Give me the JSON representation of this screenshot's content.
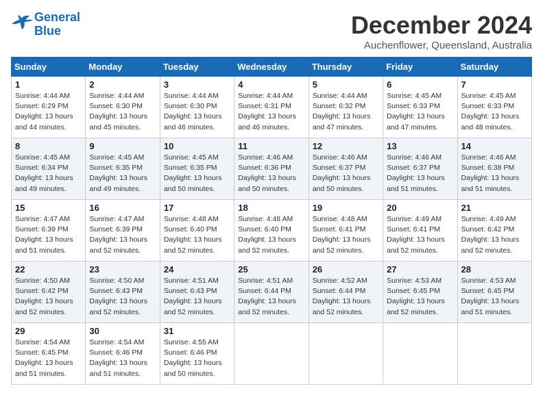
{
  "logo": {
    "line1": "General",
    "line2": "Blue"
  },
  "title": "December 2024",
  "subtitle": "Auchenflower, Queensland, Australia",
  "headers": [
    "Sunday",
    "Monday",
    "Tuesday",
    "Wednesday",
    "Thursday",
    "Friday",
    "Saturday"
  ],
  "weeks": [
    [
      {
        "day": "1",
        "info": "Sunrise: 4:44 AM\nSunset: 6:29 PM\nDaylight: 13 hours\nand 44 minutes."
      },
      {
        "day": "2",
        "info": "Sunrise: 4:44 AM\nSunset: 6:30 PM\nDaylight: 13 hours\nand 45 minutes."
      },
      {
        "day": "3",
        "info": "Sunrise: 4:44 AM\nSunset: 6:30 PM\nDaylight: 13 hours\nand 46 minutes."
      },
      {
        "day": "4",
        "info": "Sunrise: 4:44 AM\nSunset: 6:31 PM\nDaylight: 13 hours\nand 46 minutes."
      },
      {
        "day": "5",
        "info": "Sunrise: 4:44 AM\nSunset: 6:32 PM\nDaylight: 13 hours\nand 47 minutes."
      },
      {
        "day": "6",
        "info": "Sunrise: 4:45 AM\nSunset: 6:33 PM\nDaylight: 13 hours\nand 47 minutes."
      },
      {
        "day": "7",
        "info": "Sunrise: 4:45 AM\nSunset: 6:33 PM\nDaylight: 13 hours\nand 48 minutes."
      }
    ],
    [
      {
        "day": "8",
        "info": "Sunrise: 4:45 AM\nSunset: 6:34 PM\nDaylight: 13 hours\nand 49 minutes."
      },
      {
        "day": "9",
        "info": "Sunrise: 4:45 AM\nSunset: 6:35 PM\nDaylight: 13 hours\nand 49 minutes."
      },
      {
        "day": "10",
        "info": "Sunrise: 4:45 AM\nSunset: 6:35 PM\nDaylight: 13 hours\nand 50 minutes."
      },
      {
        "day": "11",
        "info": "Sunrise: 4:46 AM\nSunset: 6:36 PM\nDaylight: 13 hours\nand 50 minutes."
      },
      {
        "day": "12",
        "info": "Sunrise: 4:46 AM\nSunset: 6:37 PM\nDaylight: 13 hours\nand 50 minutes."
      },
      {
        "day": "13",
        "info": "Sunrise: 4:46 AM\nSunset: 6:37 PM\nDaylight: 13 hours\nand 51 minutes."
      },
      {
        "day": "14",
        "info": "Sunrise: 4:46 AM\nSunset: 6:38 PM\nDaylight: 13 hours\nand 51 minutes."
      }
    ],
    [
      {
        "day": "15",
        "info": "Sunrise: 4:47 AM\nSunset: 6:39 PM\nDaylight: 13 hours\nand 51 minutes."
      },
      {
        "day": "16",
        "info": "Sunrise: 4:47 AM\nSunset: 6:39 PM\nDaylight: 13 hours\nand 52 minutes."
      },
      {
        "day": "17",
        "info": "Sunrise: 4:48 AM\nSunset: 6:40 PM\nDaylight: 13 hours\nand 52 minutes."
      },
      {
        "day": "18",
        "info": "Sunrise: 4:48 AM\nSunset: 6:40 PM\nDaylight: 13 hours\nand 52 minutes."
      },
      {
        "day": "19",
        "info": "Sunrise: 4:48 AM\nSunset: 6:41 PM\nDaylight: 13 hours\nand 52 minutes."
      },
      {
        "day": "20",
        "info": "Sunrise: 4:49 AM\nSunset: 6:41 PM\nDaylight: 13 hours\nand 52 minutes."
      },
      {
        "day": "21",
        "info": "Sunrise: 4:49 AM\nSunset: 6:42 PM\nDaylight: 13 hours\nand 52 minutes."
      }
    ],
    [
      {
        "day": "22",
        "info": "Sunrise: 4:50 AM\nSunset: 6:42 PM\nDaylight: 13 hours\nand 52 minutes."
      },
      {
        "day": "23",
        "info": "Sunrise: 4:50 AM\nSunset: 6:43 PM\nDaylight: 13 hours\nand 52 minutes."
      },
      {
        "day": "24",
        "info": "Sunrise: 4:51 AM\nSunset: 6:43 PM\nDaylight: 13 hours\nand 52 minutes."
      },
      {
        "day": "25",
        "info": "Sunrise: 4:51 AM\nSunset: 6:44 PM\nDaylight: 13 hours\nand 52 minutes."
      },
      {
        "day": "26",
        "info": "Sunrise: 4:52 AM\nSunset: 6:44 PM\nDaylight: 13 hours\nand 52 minutes."
      },
      {
        "day": "27",
        "info": "Sunrise: 4:53 AM\nSunset: 6:45 PM\nDaylight: 13 hours\nand 52 minutes."
      },
      {
        "day": "28",
        "info": "Sunrise: 4:53 AM\nSunset: 6:45 PM\nDaylight: 13 hours\nand 51 minutes."
      }
    ],
    [
      {
        "day": "29",
        "info": "Sunrise: 4:54 AM\nSunset: 6:45 PM\nDaylight: 13 hours\nand 51 minutes."
      },
      {
        "day": "30",
        "info": "Sunrise: 4:54 AM\nSunset: 6:46 PM\nDaylight: 13 hours\nand 51 minutes."
      },
      {
        "day": "31",
        "info": "Sunrise: 4:55 AM\nSunset: 6:46 PM\nDaylight: 13 hours\nand 50 minutes."
      },
      {
        "day": "",
        "info": ""
      },
      {
        "day": "",
        "info": ""
      },
      {
        "day": "",
        "info": ""
      },
      {
        "day": "",
        "info": ""
      }
    ]
  ]
}
